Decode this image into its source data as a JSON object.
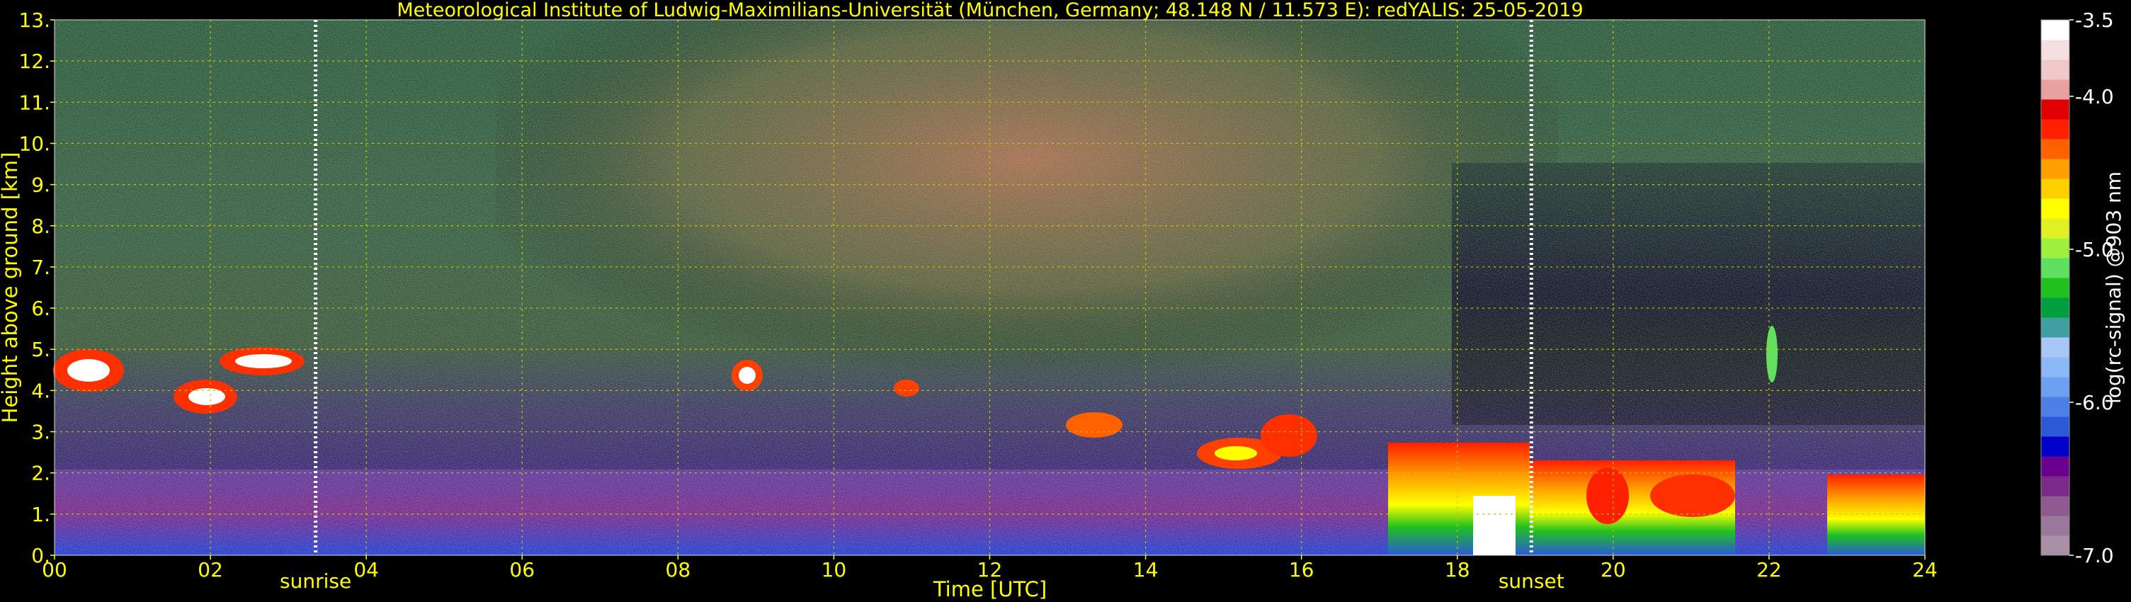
{
  "chart_data": {
    "type": "heatmap",
    "title": "Meteorological Institute of Ludwig-Maximilians-Universität (München, Germany; 48.148 N / 11.573 E):    redYALIS: 25-05-2019",
    "xlabel": "Time [UTC]",
    "ylabel": "Height above ground [km]",
    "xlim": [
      0,
      24
    ],
    "ylim": [
      0,
      13
    ],
    "x_ticks": [
      "00",
      "02",
      "04",
      "06",
      "08",
      "10",
      "12",
      "14",
      "16",
      "18",
      "20",
      "22",
      "24"
    ],
    "y_ticks": [
      "0.",
      "1.",
      "2.",
      "3.",
      "4.",
      "5.",
      "6.",
      "7.",
      "8.",
      "9.",
      "10.",
      "11.",
      "12.",
      "13."
    ],
    "grid": true,
    "markers": [
      {
        "label": "sunrise",
        "x": 3.35
      },
      {
        "label": "sunset",
        "x": 18.95
      }
    ],
    "colorbar": {
      "label": "log(rc-signal) @903 nm",
      "range": [
        -7.0,
        -3.5
      ],
      "ticks": [
        "-3.5",
        "-4.0",
        "-5.0",
        "-6.0",
        "-7.0"
      ],
      "colors": [
        "#a890a8",
        "#9a789a",
        "#8c5a8e",
        "#7b2a8a",
        "#6a0090",
        "#0000c8",
        "#2a5ad8",
        "#4a80e8",
        "#6ca0f0",
        "#8cb8f8",
        "#a8c8f8",
        "#40a0a0",
        "#00a040",
        "#20c020",
        "#60e060",
        "#a0f040",
        "#e0f020",
        "#ffff00",
        "#ffd000",
        "#ffa000",
        "#ff6000",
        "#ff2000",
        "#e00000",
        "#e8a0a0",
        "#f0c8c8",
        "#f4e0e0",
        "#ffffff"
      ]
    },
    "layers": [
      {
        "name": "boundary_layer",
        "x": [
          0,
          24
        ],
        "y": [
          0,
          2.1
        ]
      },
      {
        "name": "clouds_early",
        "x": [
          0.2,
          3.3
        ],
        "y": [
          3.5,
          5.2
        ]
      },
      {
        "name": "clouds_mid",
        "x": [
          8.5,
          16.3
        ],
        "y": [
          2.4,
          5.0
        ]
      },
      {
        "name": "clouds_evening",
        "x": [
          17.1,
          24
        ],
        "y": [
          0,
          2.4
        ]
      }
    ]
  }
}
